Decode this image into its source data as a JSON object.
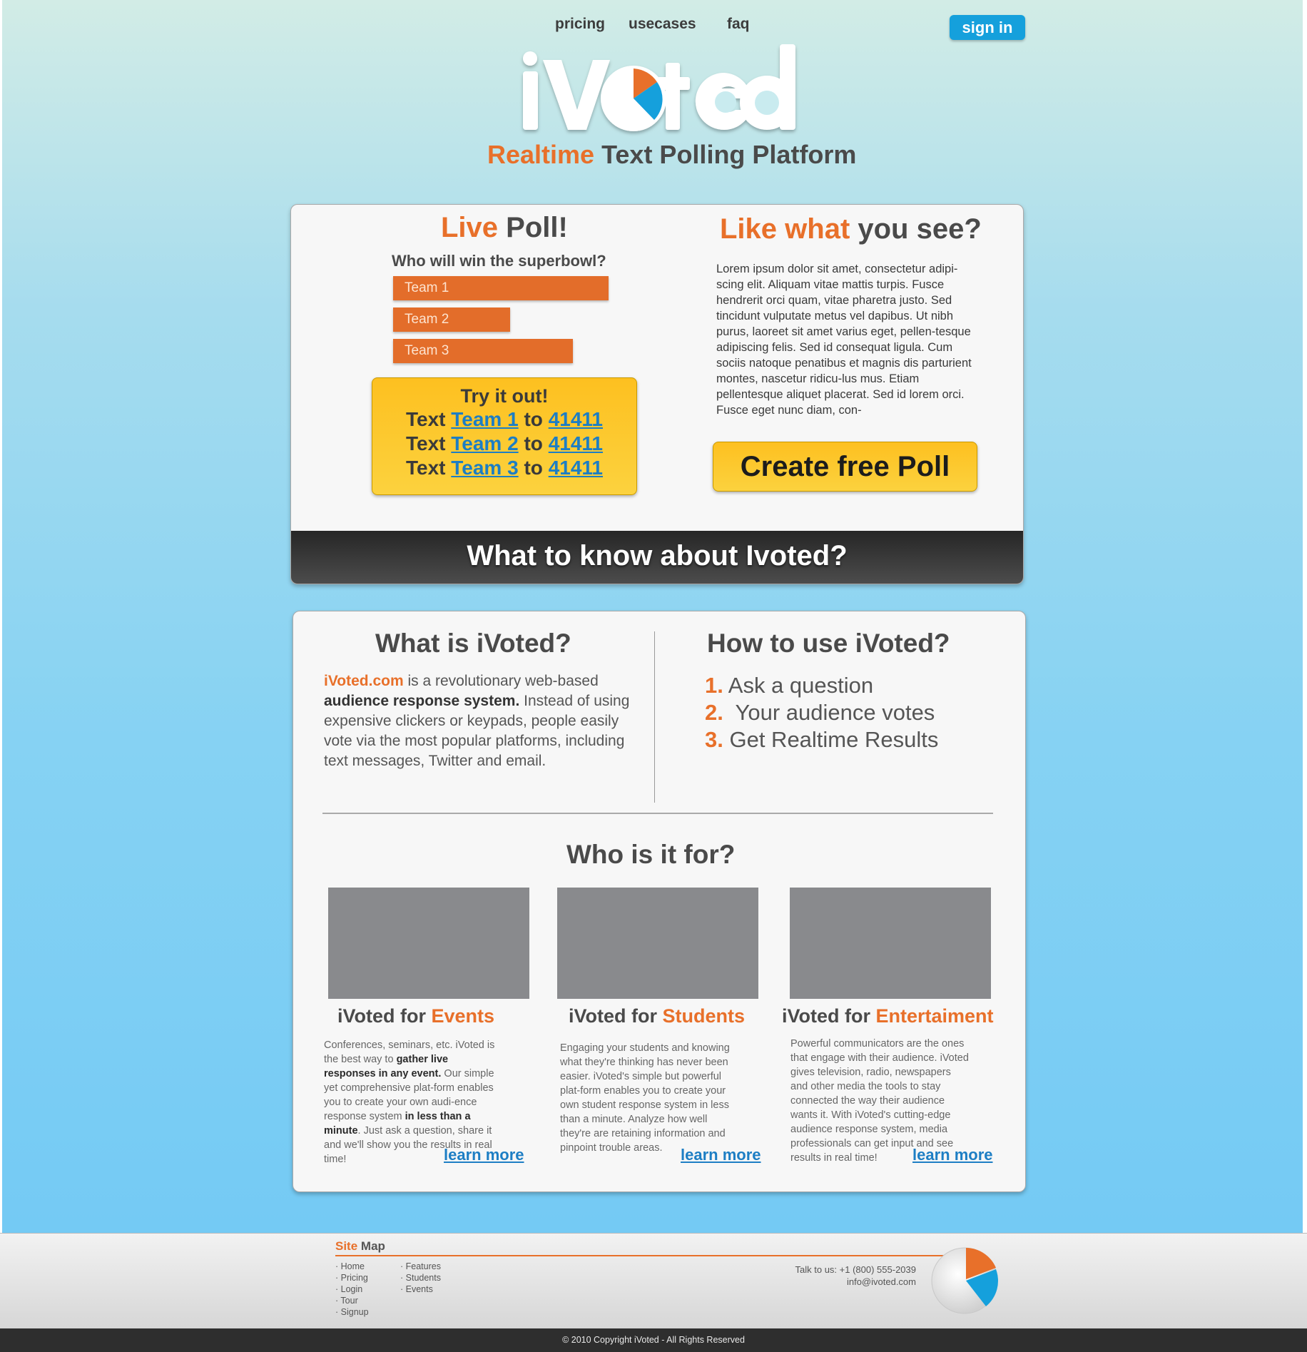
{
  "nav": {
    "pricing": "pricing",
    "usecases": "usecases",
    "faq": "faq",
    "sign_in": "sign in"
  },
  "logo": {
    "text_a": "iV",
    "text_b": "ted",
    "tagline_accent": "Realtime",
    "tagline_rest": " Text Polling Platform"
  },
  "live_poll": {
    "title_accent": "Live",
    "title_rest": " Poll!",
    "question": "Who will win the superbowl?",
    "options": [
      {
        "label": "Team 1",
        "share": 0.72
      },
      {
        "label": "Team 2",
        "share": 0.39
      },
      {
        "label": "Team 3",
        "share": 0.6
      }
    ],
    "try_title": "Try it out!",
    "lines": [
      {
        "pre": "Text ",
        "team": "Team 1",
        "mid": " to ",
        "num": "41411"
      },
      {
        "pre": "Text ",
        "team": "Team 2",
        "mid": " to ",
        "num": "41411"
      },
      {
        "pre": "Text ",
        "team": "Team 3",
        "mid": " to ",
        "num": "41411"
      }
    ]
  },
  "like": {
    "title_accent": "Like what",
    "title_rest": " you see?",
    "body": "Lorem ipsum dolor sit amet, consectetur adipi-scing elit. Aliquam vitae mattis turpis. Fusce hendrerit orci quam, vitae pharetra justo. Sed tincidunt vulputate metus vel dapibus. Ut nibh purus, laoreet sit amet varius eget, pellen-tesque adipiscing felis. Sed id consequat ligula. Cum sociis natoque penatibus et magnis dis parturient montes, nascetur ridicu-lus mus. Etiam pellentesque aliquet placerat. Sed id lorem orci. Fusce eget nunc diam, con-",
    "button": "Create free Poll"
  },
  "banner": "What to know about Ivoted?",
  "what": {
    "title": "What is iVoted?",
    "link": "iVoted.com",
    "p1": " is a revolutionary web-based ",
    "bold": "audience response system.",
    "p2": " Instead of using expensive clickers or keypads, people easily vote via the most popular platforms, including text messages, Twitter and email."
  },
  "how": {
    "title": "How to use iVoted?",
    "steps": [
      {
        "n": "1.",
        "t": " Ask a question"
      },
      {
        "n": "2.",
        "t": "  Your audience votes"
      },
      {
        "n": "3.",
        "t": " Get Realtime Results"
      }
    ]
  },
  "who": {
    "title": "Who is it for?",
    "cols": [
      {
        "pre": "iVoted for ",
        "accent": "Events",
        "t1": "Conferences, seminars, etc. iVoted is the best way to ",
        "b1": "gather live responses in any event.",
        "t2": " Our simple yet comprehensive plat-form enables you to create your own audi-ence response system ",
        "b2": "in less than a minute",
        "t3": ". Just ask a question, share it and we'll show you the results in real time!",
        "learn": "learn more"
      },
      {
        "pre": "iVoted for ",
        "accent": "Students",
        "t1": "Engaging your students and knowing what they're thinking has never been easier. iVoted's simple but powerful plat-form enables you to create your own student response system in less than a minute. Analyze how well they're are retaining information and pinpoint trouble areas.",
        "b1": "",
        "t2": "",
        "b2": "",
        "t3": "",
        "learn": "learn more"
      },
      {
        "pre": "iVoted for ",
        "accent": "Entertaiment",
        "t1": "Powerful communicators are the ones that engage with their audience. iVoted gives television, radio, newspapers and other media the tools to stay connected the way their audience wants it. With iVoted's cutting-edge audience response system, media professionals can get input and see results in real time!",
        "b1": "",
        "t2": "",
        "b2": "",
        "t3": "",
        "learn": "learn more"
      }
    ]
  },
  "footer": {
    "site_accent": "Site",
    "site_rest": " Map",
    "col1": [
      "· Home",
      "· Pricing",
      "· Login",
      "· Tour",
      "· Signup"
    ],
    "col2": [
      "· Features",
      "· Students",
      "· Events"
    ],
    "talk": "Talk to us: +1 (800) 555-2039",
    "email": "info@ivoted.com",
    "copyright": "© 2010 Copyright iVoted - All Rights Reserved"
  },
  "colors": {
    "accent": "#e8702a",
    "blue": "#15a0dc",
    "yellow": "#fdc020",
    "link": "#1d7ec4"
  }
}
